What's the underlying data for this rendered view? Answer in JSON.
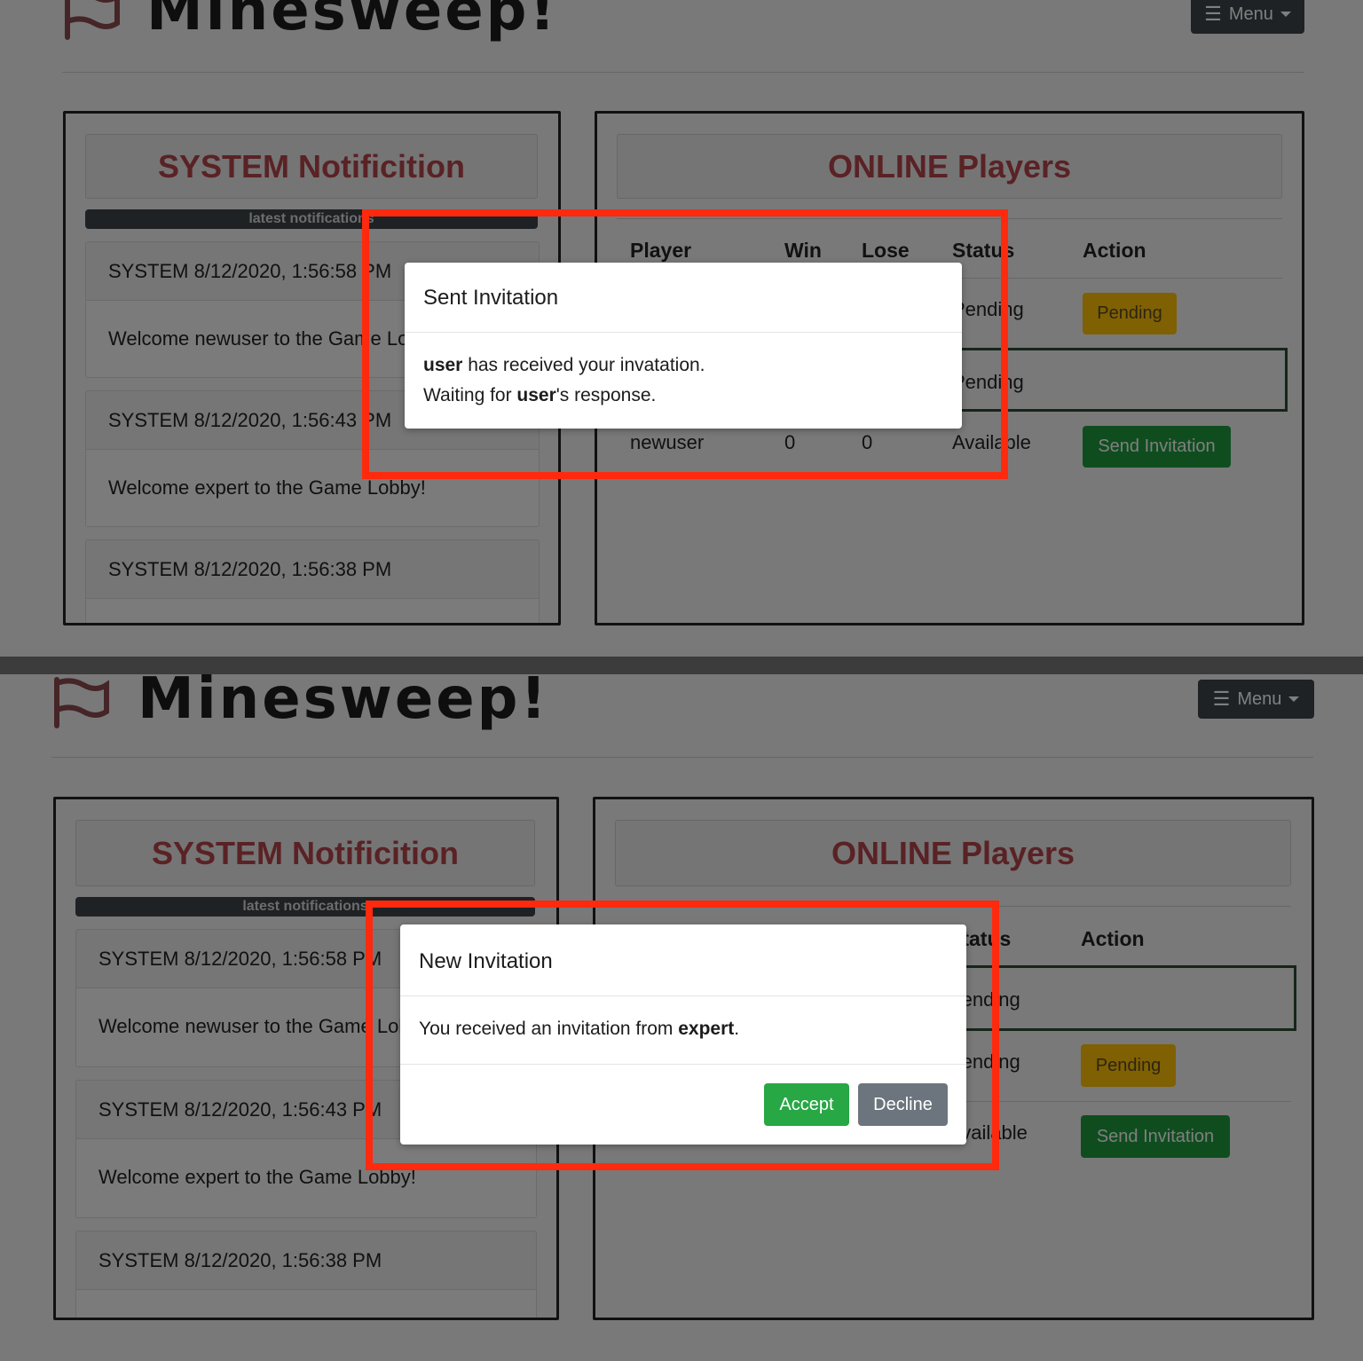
{
  "app": {
    "title": "Minesweep!",
    "menu_label": "Menu"
  },
  "notifications": {
    "heading": "SYSTEM Notificition",
    "latest_label": "latest notifications",
    "items": [
      {
        "header": "SYSTEM 8/12/2020, 1:56:58 PM",
        "body": "Welcome newuser to the Game Lobby!"
      },
      {
        "header": "SYSTEM 8/12/2020, 1:56:43 PM",
        "body": "Welcome expert to the Game Lobby!"
      },
      {
        "header": "SYSTEM 8/12/2020, 1:56:38 PM",
        "body": ""
      }
    ]
  },
  "players": {
    "heading": "ONLINE Players",
    "columns": [
      "Player",
      "Win",
      "Lose",
      "Status",
      "Action"
    ],
    "rows": [
      {
        "player": "",
        "win": "",
        "lose": "",
        "status": "Pending",
        "action": "Pending"
      },
      {
        "player": "",
        "win": "",
        "lose": "",
        "status": "Pending",
        "action": ""
      },
      {
        "player": "newuser",
        "win": "0",
        "lose": "0",
        "status": "Available",
        "action": "Send Invitation"
      }
    ]
  },
  "sent_modal": {
    "title": "Sent Invitation",
    "line1_user": "user",
    "line1_rest": " has received your invatation.",
    "line2_prefix": "Waiting for ",
    "line2_user": "user",
    "line2_suffix": "'s response."
  },
  "new_modal": {
    "title": "New Invitation",
    "text_prefix": "You received an invitation from ",
    "text_user": "expert",
    "text_suffix": ".",
    "accept_label": "Accept",
    "decline_label": "Decline"
  },
  "colors": {
    "heading_red": "#b4444b",
    "highlight": "#ff2a0e",
    "accept": "#28a745",
    "decline": "#6c757d",
    "send": "#1e9a3e",
    "pending": "#ffc107"
  }
}
